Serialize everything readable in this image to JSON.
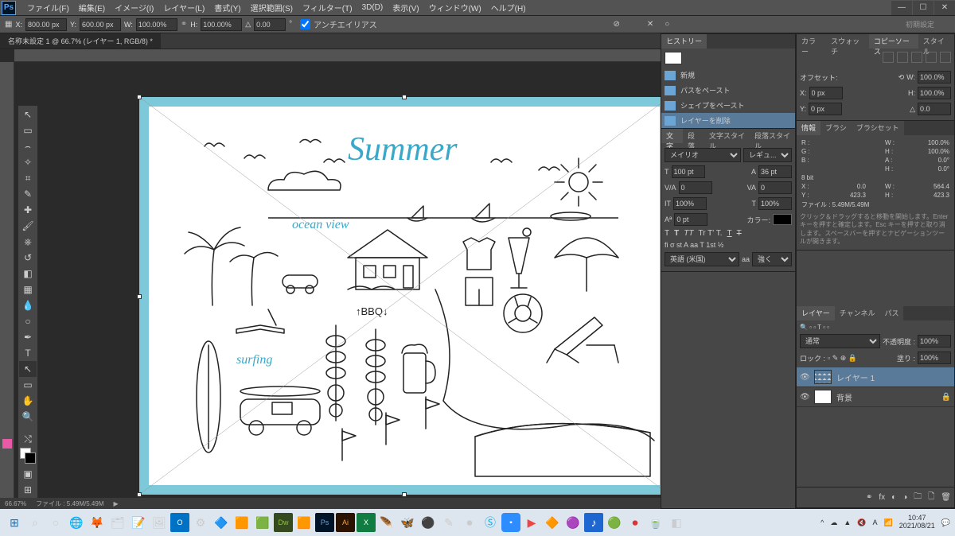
{
  "menu": [
    "ファイル(F)",
    "編集(E)",
    "イメージ(I)",
    "レイヤー(L)",
    "書式(Y)",
    "選択範囲(S)",
    "フィルター(T)",
    "3D(D)",
    "表示(V)",
    "ウィンドウ(W)",
    "ヘルプ(H)"
  ],
  "options": {
    "x_label": "X:",
    "x_val": "800.00 px",
    "y_label": "Y:",
    "y_val": "600.00 px",
    "w_label": "W:",
    "w_val": "100.00%",
    "h_label": "H:",
    "h_val": "100.00%",
    "angle_label": "△",
    "angle_val": "0.00",
    "antialias": "アンチエイリアス",
    "setting": "初期設定"
  },
  "tab_title": "名称未設定 1 @ 66.7% (レイヤー 1, RGB/8) *",
  "history": {
    "title": "ヒストリー",
    "items": [
      "新規",
      "パスをペースト",
      "シェイプをペースト",
      "レイヤーを削除"
    ]
  },
  "char_panel": {
    "tabs": [
      "文字",
      "段落",
      "文字スタイル",
      "段落スタイル"
    ],
    "font": "メイリオ",
    "style": "レギュ...",
    "size": "100 pt",
    "leading": "36 pt",
    "va": "0",
    "vb": "0",
    "scale_v": "100%",
    "scale_h": "100%",
    "baseline": "0 pt",
    "color_label": "カラー:",
    "lang": "英語 (米国)",
    "aa": "aa",
    "sharp": "強く"
  },
  "swatches_tabs": [
    "カラー",
    "スウォッチ",
    "コピーソース",
    "スタイル"
  ],
  "source_panel": {
    "offset": "オフセット:",
    "x": "X:",
    "xval": "0 px",
    "w": "W:",
    "wval": "100.0%",
    "y": "Y:",
    "yval": "0 px",
    "h": "H:",
    "hval": "100.0%",
    "a": "△",
    "aval": "0.0"
  },
  "info_panel": {
    "tabs": [
      "情報",
      "ブラシ",
      "ブラシセット"
    ],
    "r": "R :",
    "g": "G :",
    "b": "B :",
    "a": "A :",
    "h2": "H :",
    "wp": "W :",
    "wpv": "100.0%",
    "hp": "H :",
    "hpv": "100.0%",
    "ap": "A :",
    "apv": "0.0°",
    "hp2": "H :",
    "hpv2": "0.0°",
    "bit": "8 bit",
    "x": "X :",
    "xv": "0.0",
    "y": "Y :",
    "yv": "423.3",
    "w": "W :",
    "wv": "564.4",
    "h": "H :",
    "hv": "423.3",
    "file": "ファイル : 5.49M/5.49M",
    "hint": "クリック＆ドラッグすると移動を開始します。Enter キーを押すと確定します。Esc キーを押すと取り消します。スペースバーを押すとナビゲーションツールが開きます。"
  },
  "layers_panel": {
    "tabs": [
      "レイヤー",
      "チャンネル",
      "パス"
    ],
    "blend": "通常",
    "opacity_label": "不透明度 :",
    "opacity": "100%",
    "lock": "ロック :",
    "fill_label": "塗り :",
    "fill": "100%",
    "items": [
      {
        "name": "レイヤー 1",
        "sel": true
      },
      {
        "name": "背景",
        "sel": false
      }
    ]
  },
  "status": {
    "zoom": "66.67%",
    "file": "ファイル : 5.49M/5.49M"
  },
  "artwork": {
    "title": "Summer",
    "ocean": "ocean view",
    "surfing": "surfing",
    "bbq": "↑BBQ↓"
  },
  "clock": {
    "time": "10:47",
    "date": "2021/08/21"
  }
}
